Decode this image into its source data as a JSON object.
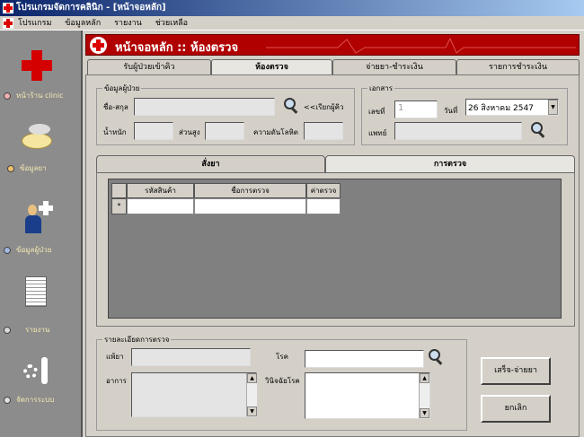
{
  "window": {
    "title": "โปรแกรมจัดการคลินิก - [หน้าจอหลัก]"
  },
  "menu": [
    "โปรแกรม",
    "ข้อมูลหลัก",
    "รายงาน",
    "ช่วยเหลือ"
  ],
  "sidebar": {
    "items": [
      {
        "label": "หน้าร้าน clinic",
        "icon": "red-cross-icon",
        "dot": "#f0b0b0"
      },
      {
        "label": "ข้อมูลยา",
        "icon": "pill-icon",
        "dot": "#f0c070"
      },
      {
        "label": "ข้อมูลผู้ป่วย",
        "icon": "patient-icon",
        "dot": "#a0b8e0"
      },
      {
        "label": "รายงาน",
        "icon": "report-icon",
        "dot": "#d8d8d8"
      },
      {
        "label": "จัดการระบบ",
        "icon": "settings-icon",
        "dot": "#e0e0e0"
      }
    ]
  },
  "banner": {
    "title": "หน้าจอหลัก :: ห้องตรวจ",
    "accent": "#b00000"
  },
  "tabs": [
    {
      "label": "รับผู้ป่วยเข้าคิว"
    },
    {
      "label": "ห้องตรวจ",
      "active": true
    },
    {
      "label": "จ่ายยา-ชำระเงิน"
    },
    {
      "label": "รายการชำระเงิน"
    }
  ],
  "patient": {
    "legend": "ข้อมูลผู้ป่วย",
    "name_label": "ชื่อ-สกุล",
    "name_value": "",
    "call_queue": "<<เรียกผู้คิว",
    "weight_label": "น้ำหนัก",
    "height_label": "ส่วนสูง",
    "bp_label": "ความดันโลหิต"
  },
  "document": {
    "legend": "เอกสาร",
    "number_label": "เลขที่",
    "number_value": "1",
    "date_label": "วันที่",
    "date_value": "26  สิงหาคม    2547",
    "doctor_label": "แพทย์"
  },
  "inner_tabs": [
    {
      "label": "สั่งยา"
    },
    {
      "label": "การตรวจ",
      "active": true
    }
  ],
  "grid": {
    "columns": [
      "รหัสสินค้า",
      "ชื่อการตรวจ",
      "ค่าตรวจ"
    ],
    "new_row_marker": "*"
  },
  "details": {
    "legend": "รายละเอียดการตรวจ",
    "allergy_label": "แพ้ยา",
    "symptom_label": "อาการ",
    "disease_label": "โรค",
    "diagnosis_label": "วินิจฉัยโรค"
  },
  "buttons": {
    "finish": "เสร็จ-จ่ายยา",
    "cancel": "ยกเลิก"
  }
}
